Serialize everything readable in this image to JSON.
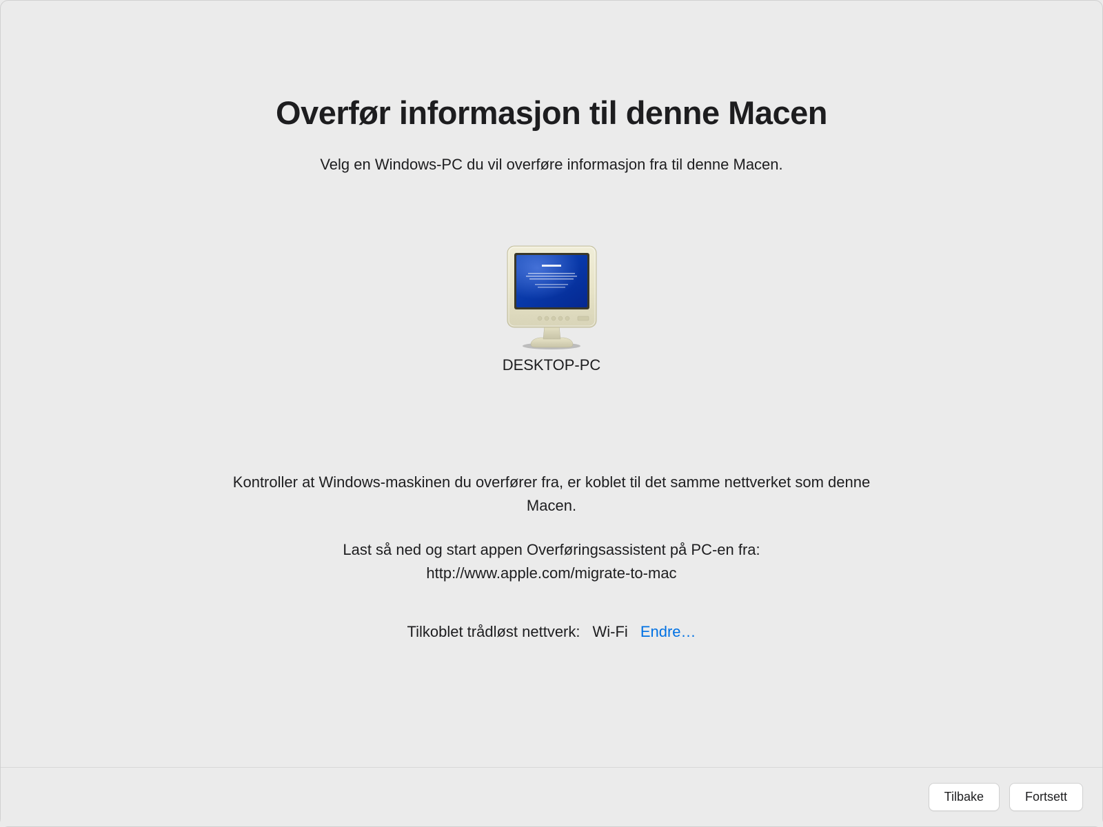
{
  "title": "Overfør informasjon til denne Macen",
  "subtitle": "Velg en Windows-PC du vil overføre informasjon fra til denne Macen.",
  "device": {
    "name": "DESKTOP-PC"
  },
  "instructions": {
    "line1": "Kontroller at Windows-maskinen du overfører fra, er koblet til det samme nettverket som denne Macen.",
    "line2": "Last så ned og start appen Overføringsassistent på PC-en fra:",
    "url": "http://www.apple.com/migrate-to-mac"
  },
  "network": {
    "label": "Tilkoblet trådløst nettverk:",
    "name": "Wi-Fi",
    "change_label": "Endre…"
  },
  "buttons": {
    "back": "Tilbake",
    "continue": "Fortsett"
  }
}
